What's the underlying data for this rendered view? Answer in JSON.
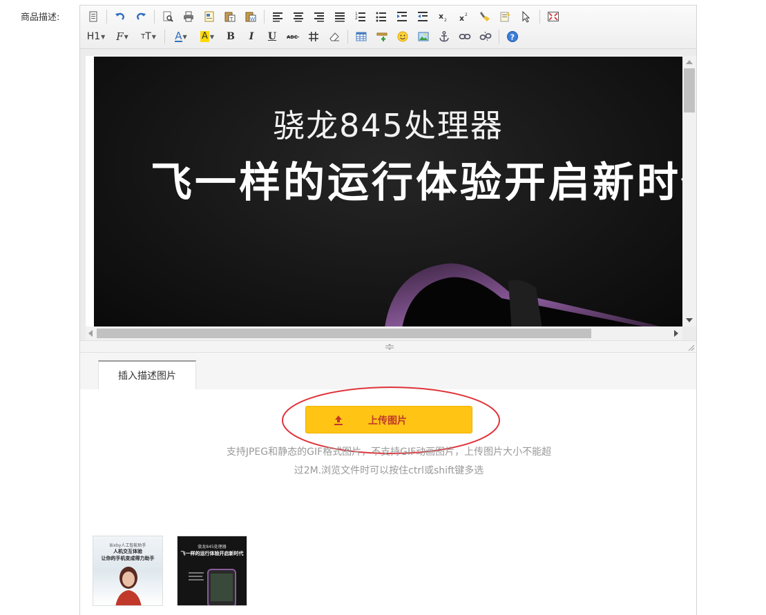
{
  "field_label": "商品描述:",
  "editor": {
    "banner": {
      "subtitle": "骁龙845处理器",
      "headline": "飞一样的运行体验开启新时代"
    }
  },
  "tabs": [
    {
      "label": "插入描述图片",
      "active": true
    }
  ],
  "upload": {
    "button_label": "上传图片",
    "hint_line1": "支持JPEG和静态的GIF格式图片，不支持GIF动画图片，上传图片大小不能超",
    "hint_line2": "过2M.浏览文件时可以按住ctrl或shift键多选"
  },
  "thumbnails": [
    {
      "line1": "Bixby人工智能助手",
      "line2": "人机交互体验",
      "line3": "让你的手机变成得力助手"
    },
    {
      "line1": "骁龙845处理器",
      "line2": "飞一样的运行体验开启新时代"
    }
  ],
  "colors": {
    "upload_button": "#ffc414",
    "upload_label": "#c0392b",
    "highlight_ellipse": "#e0333a"
  }
}
